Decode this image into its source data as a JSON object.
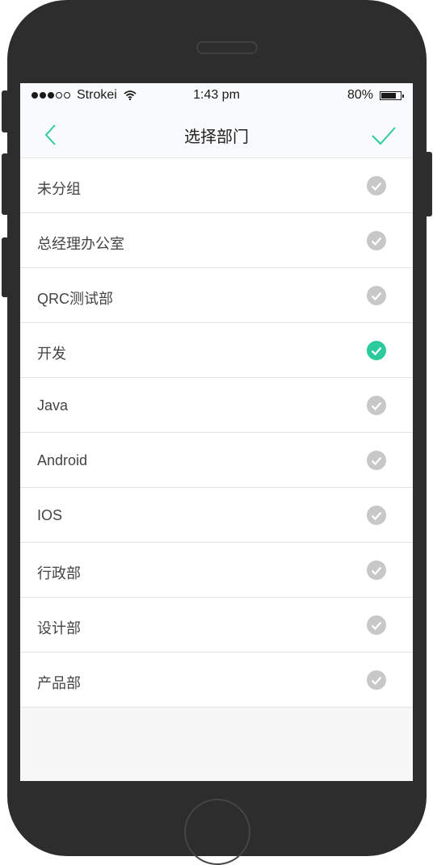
{
  "status_bar": {
    "carrier": "Strokei",
    "time": "1:43 pm",
    "battery": "80%",
    "battery_level": 0.8
  },
  "nav": {
    "title": "选择部门",
    "back_icon": "chevron-left-icon",
    "confirm_icon": "check-icon"
  },
  "colors": {
    "accent": "#2ccb9e",
    "unchecked": "#c8c8c8",
    "phone_body": "#2d2d2d"
  },
  "departments": [
    {
      "label": "未分组",
      "selected": false
    },
    {
      "label": "总经理办公室",
      "selected": false
    },
    {
      "label": "QRC测试部",
      "selected": false
    },
    {
      "label": "开发",
      "selected": true
    },
    {
      "label": "Java",
      "selected": false
    },
    {
      "label": "Android",
      "selected": false
    },
    {
      "label": "IOS",
      "selected": false
    },
    {
      "label": "行政部",
      "selected": false
    },
    {
      "label": "设计部",
      "selected": false
    },
    {
      "label": "产品部",
      "selected": false
    }
  ]
}
